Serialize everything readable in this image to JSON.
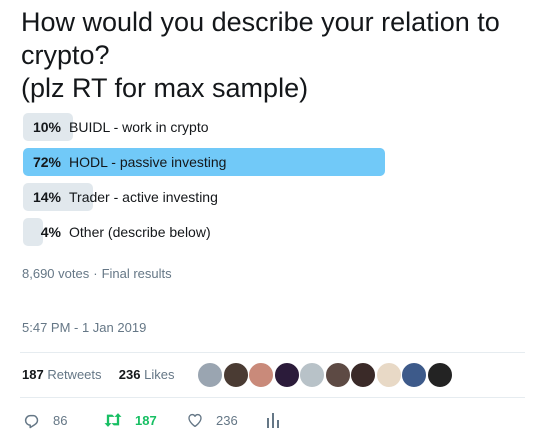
{
  "poll": {
    "question": "How would you describe your relation to crypto?\n(plz RT for max sample)",
    "options": [
      {
        "percent_label": "10%",
        "label": "BUIDL - work in crypto",
        "percent": 10
      },
      {
        "percent_label": "72%",
        "label": "HODL - passive investing",
        "percent": 72
      },
      {
        "percent_label": "14%",
        "label": "Trader - active investing",
        "percent": 14
      },
      {
        "percent_label": "4%",
        "label": "Other (describe below)",
        "percent": 4
      }
    ],
    "votes": "8,690 votes",
    "separator": "·",
    "status": "Final results"
  },
  "tweet": {
    "timestamp": "5:47 PM - 1 Jan 2019"
  },
  "stats": {
    "retweets_count": "187",
    "retweets_label": "Retweets",
    "likes_count": "236",
    "likes_label": "Likes",
    "avatar_colors": [
      "#9aa5b1",
      "#4a3b33",
      "#c98a7a",
      "#2b1b3a",
      "#b8c2c8",
      "#5d4a44",
      "#3a2a28",
      "#e8d9c6",
      "#3d5a8a",
      "#232323"
    ]
  },
  "actions": {
    "reply_count": "86",
    "retweet_count": "187",
    "like_count": "236",
    "icons": [
      "reply-icon",
      "retweet-icon",
      "heart-icon",
      "analytics-icon"
    ]
  },
  "colors": {
    "winner_fill": "#71c9f8",
    "option_fill": "#e1e8ed",
    "muted_text": "#657786",
    "retweet_green": "#17bf63"
  }
}
